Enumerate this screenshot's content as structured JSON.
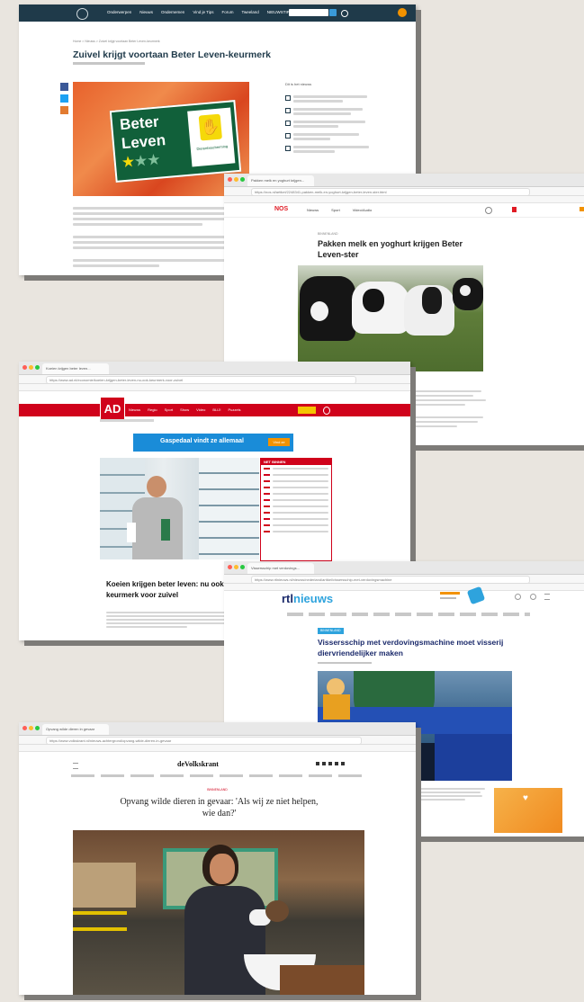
{
  "shot1": {
    "nav_items": [
      "Onderwerpen",
      "Nieuws",
      "Ondernemen",
      "Vind je Tips",
      "Forum",
      "Tweeland",
      "NIEUWSTIP"
    ],
    "breadcrumb": "Home  >  Nieuws  >  Zuivel krijgt voortaan Beter Leven-keurmerk",
    "title": "Zuivel krijgt voortaan Beter Leven-keurmerk",
    "logo_line1": "Beter",
    "logo_line2": "Leven",
    "logo_side": "Dierenbescherming",
    "sidebar_heading": "Dit is het nieuws"
  },
  "shot2": {
    "tab": "Pakken melk en yoghurt krijgen...",
    "url": "https://nos.nl/artikel/2248341-pakken-melk-en-yoghurt-krijgen-beter-leven-ster.html",
    "brand": "NOS",
    "nav_items": [
      "Nieuws",
      "Sport",
      "Video/Audio"
    ],
    "kicker": "BINNENLAND",
    "headline": "Pakken melk en yoghurt krijgen Beter Leven-ster"
  },
  "shot3": {
    "tab": "Koeien krijgen beter leven...",
    "url": "https://www.ad.nl/economie/koeien-krijgen-beter-leven-nu-ook-keurmerk-voor-zuivel",
    "brand": "AD",
    "nav_items": [
      "Nieuws",
      "Regio",
      "Sport",
      "Show",
      "Video",
      "BLIJ!",
      "Puzzels"
    ],
    "ad_text": "Gaspedaal vindt ze allemaal",
    "ad_button": "Vind ze",
    "sidebar_heading": "NET BINNEN",
    "headline": "Koeien krijgen beter leven: nu ook keurmerk voor zuivel"
  },
  "shot4": {
    "tab": "Vissersschip met verdovings...",
    "url": "https://www.rtlnieuws.nl/nieuws/nederland/artikel/vissersschip-met-verdovingsmachine",
    "brand_rtl": "rtl",
    "brand_nieuws": "nieuws",
    "kicker": "BINNENLAND",
    "headline": "Vissersschip met verdovingsmachine moet visserij diervriendelijker maken"
  },
  "shot5": {
    "tab": "Opvang wilde dieren in gevaar",
    "url": "https://www.volkskrant.nl/nieuws-achtergrond/opvang-wilde-dieren-in-gevaar",
    "brand": "deVolkskrant",
    "kicker": "BINNENLAND",
    "headline": "Opvang wilde dieren in gevaar: 'Als wij ze niet helpen, wie dan?'"
  },
  "colors": {
    "background": "#e9e5df",
    "shot1_nav": "#1f3a4a",
    "nos_red": "#e01b24",
    "ad_red": "#d0021b",
    "rtl_blue": "#1b2a6b",
    "logo_green": "#11603a"
  }
}
